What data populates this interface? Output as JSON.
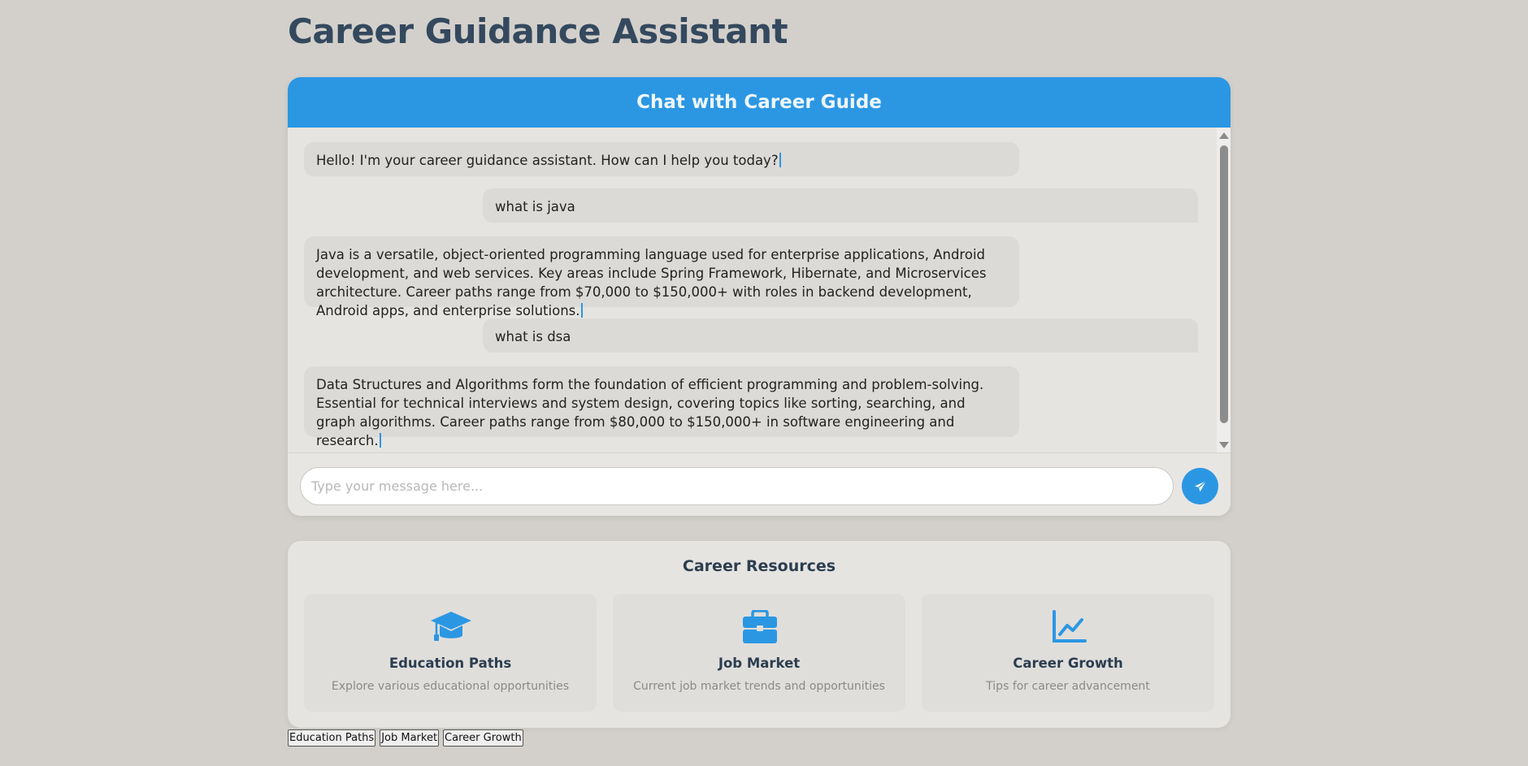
{
  "page": {
    "title": "Career Guidance Assistant"
  },
  "chat": {
    "header": "Chat with Career Guide",
    "messages": [
      {
        "role": "bot",
        "text": "Hello! I'm your career guidance assistant. How can I help you today?"
      },
      {
        "role": "user",
        "text": "what is java"
      },
      {
        "role": "bot",
        "text": "Java is a versatile, object-oriented programming language used for enterprise applications, Android development, and web services. Key areas include Spring Framework, Hibernate, and Microservices architecture. Career paths range from $70,000 to $150,000+ with roles in backend development, Android apps, and enterprise solutions."
      },
      {
        "role": "user",
        "text": "what is dsa"
      },
      {
        "role": "bot",
        "text": "Data Structures and Algorithms form the foundation of efficient programming and problem-solving. Essential for technical interviews and system design, covering topics like sorting, searching, and graph algorithms. Career paths range from $80,000 to $150,000+ in software engineering and research."
      }
    ],
    "input": {
      "placeholder": "Type your message here...",
      "value": ""
    },
    "send_icon": "paper-plane-icon"
  },
  "resources": {
    "title": "Career Resources",
    "items": [
      {
        "icon": "graduation-cap-icon",
        "name": "Education Paths",
        "desc": "Explore various educational opportunities"
      },
      {
        "icon": "briefcase-icon",
        "name": "Job Market",
        "desc": "Current job market trends and opportunities"
      },
      {
        "icon": "chart-line-icon",
        "name": "Career Growth",
        "desc": "Tips for career advancement"
      }
    ]
  },
  "bottom_buttons": [
    "Education Paths",
    "Job Market",
    "Career Growth"
  ],
  "colors": {
    "accent": "#2b97e3",
    "title": "#34495e",
    "background": "#d3d0cb"
  }
}
